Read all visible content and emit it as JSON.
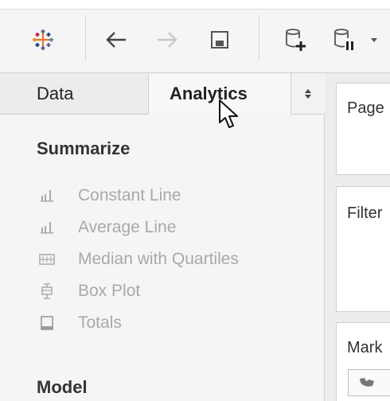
{
  "toolbar": {
    "buttons": [
      {
        "name": "tableau-logo-icon"
      },
      {
        "name": "back-arrow-icon"
      },
      {
        "name": "forward-arrow-icon"
      },
      {
        "name": "save-icon"
      },
      {
        "name": "new-data-source-icon"
      },
      {
        "name": "pause-updates-icon"
      },
      {
        "name": "dropdown-caret-icon"
      }
    ]
  },
  "tabs": {
    "data": "Data",
    "analytics": "Analytics"
  },
  "summarize": {
    "title": "Summarize",
    "items": [
      {
        "label": "Constant Line",
        "icon": "constant-line-icon"
      },
      {
        "label": "Average Line",
        "icon": "average-line-icon"
      },
      {
        "label": "Median with Quartiles",
        "icon": "median-quartiles-icon"
      },
      {
        "label": "Box Plot",
        "icon": "box-plot-icon"
      },
      {
        "label": "Totals",
        "icon": "totals-icon"
      }
    ]
  },
  "model": {
    "title": "Model"
  },
  "shelves": {
    "pages": "Page",
    "filters": "Filter",
    "marks": "Mark"
  },
  "colors": {
    "disabled_text": "#a9a9a9",
    "panel_bg": "#f5f5f5"
  }
}
